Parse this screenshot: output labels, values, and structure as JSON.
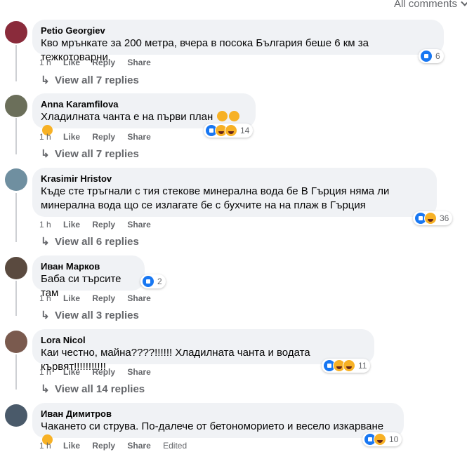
{
  "sort": {
    "label": "All comments"
  },
  "action_labels": {
    "like": "Like",
    "reply": "Reply",
    "share": "Share"
  },
  "comments": [
    {
      "author": "Petio Georgiev",
      "text": "Кво мрънкате за 200 метра, вчера в посока България беше 6 км за тежкотоварни",
      "time": "1 h",
      "reactions": "6",
      "replies": "View all 7 replies",
      "avatar_color": "#8a2b3b"
    },
    {
      "author": "Anna Karamfilova",
      "text": "Хладилната чанта е на първи план",
      "time": "1 h",
      "reactions": "14",
      "replies": "View all 7 replies",
      "avatar_color": "#6b6f5a"
    },
    {
      "author": "Krasimir Hristov",
      "text": "Къде сте тръгнали с тия стекове минерална вода бе В Гърция няма ли минерална вода що се излагате бе с бухчите на на плаж в Гърция",
      "time": "1 h",
      "reactions": "36",
      "replies": "View all 6 replies",
      "avatar_color": "#6f8fa0"
    },
    {
      "author": "Иван Марков",
      "text": "Баба си търсите там",
      "time": "1 h",
      "reactions": "2",
      "replies": "View all 3 replies",
      "avatar_color": "#5a4a3f"
    },
    {
      "author": "Lora Nicol",
      "text": "Каи честно, майна????!!!!!! Хладилната чанта и водата кървят!!!!!!!!!!!",
      "time": "1 h",
      "reactions": "11",
      "replies": "View all 14 replies",
      "avatar_color": "#7a5a4e"
    },
    {
      "author": "Иван Димитров",
      "text": "Чакането си струва. По-далече от бетономорието и весело изкарване",
      "time": "1 h",
      "reactions": "10",
      "edited": "Edited",
      "avatar_color": "#4a5a6a"
    }
  ]
}
